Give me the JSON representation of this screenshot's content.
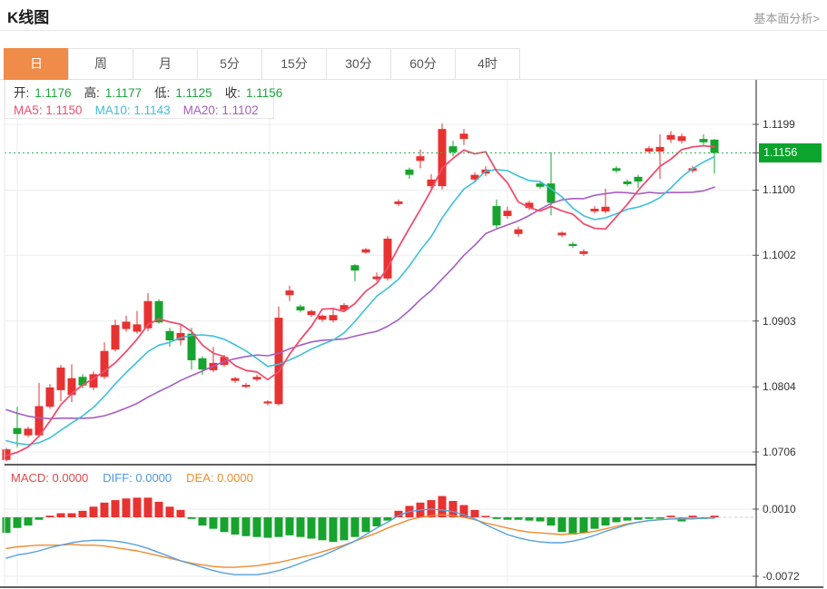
{
  "header": {
    "title": "K线图",
    "link": "基本面分析>"
  },
  "tabs": {
    "selected_key": "day",
    "items": [
      {
        "key": "day",
        "label": "日"
      },
      {
        "key": "week",
        "label": "周"
      },
      {
        "key": "month",
        "label": "月"
      },
      {
        "key": "5min",
        "label": "5分"
      },
      {
        "key": "15min",
        "label": "15分"
      },
      {
        "key": "30min",
        "label": "30分"
      },
      {
        "key": "60min",
        "label": "60分"
      },
      {
        "key": "4hour",
        "label": "4时"
      }
    ]
  },
  "legend": {
    "ohlc": [
      {
        "label": "开:",
        "value": "1.1176"
      },
      {
        "label": "高:",
        "value": "1.1177"
      },
      {
        "label": "低:",
        "value": "1.1125"
      },
      {
        "label": "收:",
        "value": "1.1156"
      }
    ],
    "ma": [
      {
        "label": "MA5:",
        "value": "1.1150",
        "color_key": "ma5"
      },
      {
        "label": "MA10:",
        "value": "1.1143",
        "color_key": "ma10"
      },
      {
        "label": "MA20:",
        "value": "1.1102",
        "color_key": "ma20"
      }
    ]
  },
  "macd_header": [
    {
      "label": "MACD:",
      "value": "0.0000",
      "color": "#e04848"
    },
    {
      "label": "DIFF:",
      "value": "0.0000",
      "color": "#4f97e0"
    },
    {
      "label": "DEA:",
      "value": "0.0000",
      "color": "#ef8e2c"
    }
  ],
  "colors": {
    "up": "#e73232",
    "down": "#17a32e",
    "ma5": "#ef4e6e",
    "ma10": "#3ec0d8",
    "ma20": "#a55ec2",
    "diff": "#57a0e0",
    "dea": "#ef8a2e",
    "ohlc_value": "#1da63d",
    "label_text": "#333333",
    "current_line": "#2db24f",
    "price_tag_bg": "#0ba42c",
    "tab_accent": "#ef8c49",
    "grid": "#ededed",
    "frame_dark": "#2b2b2b",
    "frame_light": "#e8e8e8"
  },
  "chart_data": {
    "type": "candlestick+macd",
    "title": "K线图",
    "legend_position": "top-left",
    "grid": true,
    "price_pane": {
      "y_ticks": [
        "1.1199",
        "1.1100",
        "1.1002",
        "1.0903",
        "1.0804",
        "1.0706"
      ],
      "current_price": "1.1156",
      "ma_periods": [
        5,
        10,
        20
      ],
      "ma_preroll_closes": [
        1.084,
        1.0836,
        1.0832,
        1.0828,
        1.0824,
        1.082,
        1.0815,
        1.081,
        1.0805,
        1.08,
        1.079,
        1.0775,
        1.076,
        1.0745,
        1.073,
        1.0718,
        1.0708,
        1.07,
        1.0694,
        1.069
      ],
      "candles_ohlc": [
        [
          1.0694,
          1.0712,
          1.0692,
          1.071
        ],
        [
          1.0742,
          1.0774,
          1.0713,
          1.0733
        ],
        [
          1.0731,
          1.0744,
          1.0728,
          1.0741
        ],
        [
          1.0731,
          1.081,
          1.0728,
          1.0775
        ],
        [
          1.0774,
          1.0808,
          1.0771,
          1.0803
        ],
        [
          1.0799,
          1.0837,
          1.0782,
          1.0833
        ],
        [
          1.0792,
          1.0838,
          1.0781,
          1.0817
        ],
        [
          1.0819,
          1.0823,
          1.0802,
          1.0806
        ],
        [
          1.0803,
          1.0827,
          1.0799,
          1.0823
        ],
        [
          1.0819,
          1.0871,
          1.0816,
          1.0858
        ],
        [
          1.086,
          1.0905,
          1.0857,
          1.0897
        ],
        [
          1.0891,
          1.0911,
          1.0887,
          1.0902
        ],
        [
          1.0887,
          1.0918,
          1.0884,
          1.0898
        ],
        [
          1.0892,
          1.0945,
          1.0888,
          1.0933
        ],
        [
          1.0933,
          1.0936,
          1.0899,
          1.0901
        ],
        [
          1.0888,
          1.0893,
          1.0864,
          1.0874
        ],
        [
          1.0874,
          1.0899,
          1.0867,
          1.0885
        ],
        [
          1.0884,
          1.0893,
          1.083,
          1.0844
        ],
        [
          1.0847,
          1.085,
          1.0822,
          1.083
        ],
        [
          1.0829,
          1.0864,
          1.0826,
          1.084
        ],
        [
          1.0837,
          1.0852,
          1.0834,
          1.0849
        ],
        [
          1.0813,
          1.0819,
          1.081,
          1.0817
        ],
        [
          1.0804,
          1.081,
          1.0802,
          1.0807
        ],
        [
          1.0815,
          1.0822,
          1.0812,
          1.0819
        ],
        [
          1.0779,
          1.0784,
          1.0776,
          1.0782
        ],
        [
          1.0778,
          1.0925,
          1.0776,
          1.0908
        ],
        [
          1.0942,
          1.0956,
          1.0933,
          1.0949
        ],
        [
          1.0925,
          1.0928,
          1.0916,
          1.0919
        ],
        [
          1.0912,
          1.092,
          1.0909,
          1.0918
        ],
        [
          1.0905,
          1.0913,
          1.0902,
          1.0911
        ],
        [
          1.0904,
          1.0922,
          1.0901,
          1.0912
        ],
        [
          1.092,
          1.093,
          1.0917,
          1.0927
        ],
        [
          1.0987,
          1.0989,
          1.0963,
          1.0979
        ],
        [
          1.1006,
          1.1013,
          1.1004,
          1.1011
        ],
        [
          1.0966,
          1.0976,
          1.0963,
          1.097
        ],
        [
          1.0967,
          1.1031,
          1.0964,
          1.1027
        ],
        [
          1.1079,
          1.1086,
          1.1076,
          1.1083
        ],
        [
          1.1131,
          1.1134,
          1.1117,
          1.1123
        ],
        [
          1.1144,
          1.1161,
          1.1133,
          1.1151
        ],
        [
          1.1106,
          1.1124,
          1.1102,
          1.1116
        ],
        [
          1.1106,
          1.12,
          1.1101,
          1.1192
        ],
        [
          1.1166,
          1.1174,
          1.1151,
          1.1157
        ],
        [
          1.1177,
          1.1192,
          1.1168,
          1.1185
        ],
        [
          1.1116,
          1.1127,
          1.1112,
          1.1123
        ],
        [
          1.1125,
          1.1136,
          1.1121,
          1.1131
        ],
        [
          1.1076,
          1.1086,
          1.1042,
          1.1047
        ],
        [
          1.1061,
          1.1075,
          1.1057,
          1.1069
        ],
        [
          1.1034,
          1.1045,
          1.103,
          1.1041
        ],
        [
          1.1073,
          1.1084,
          1.107,
          1.1081
        ],
        [
          1.111,
          1.1113,
          1.1102,
          1.1105
        ],
        [
          1.111,
          1.1157,
          1.1062,
          1.1081
        ],
        [
          1.1032,
          1.1038,
          1.1029,
          1.1036
        ],
        [
          1.1019,
          1.1022,
          1.1013,
          1.1016
        ],
        [
          1.1004,
          1.1011,
          1.1001,
          1.1008
        ],
        [
          1.1068,
          1.1076,
          1.1065,
          1.1072
        ],
        [
          1.1068,
          1.1102,
          1.1065,
          1.1075
        ],
        [
          1.1133,
          1.1136,
          1.1126,
          1.1129
        ],
        [
          1.1113,
          1.1116,
          1.1106,
          1.1109
        ],
        [
          1.112,
          1.1123,
          1.1103,
          1.1113
        ],
        [
          1.1158,
          1.1166,
          1.1155,
          1.1163
        ],
        [
          1.1158,
          1.1184,
          1.1117,
          1.1165
        ],
        [
          1.1176,
          1.1189,
          1.1171,
          1.1183
        ],
        [
          1.1174,
          1.1185,
          1.117,
          1.1181
        ],
        [
          1.1129,
          1.1136,
          1.1126,
          1.1133
        ],
        [
          1.1177,
          1.1184,
          1.1168,
          1.1172
        ],
        [
          1.1176,
          1.1177,
          1.1125,
          1.1156
        ]
      ]
    },
    "macd_pane": {
      "y_ticks": [
        "0.0010",
        "-0.0072"
      ],
      "bars": [
        -0.0019,
        -0.0013,
        -0.001,
        -0.0003,
        0.0002,
        0.0005,
        0.0005,
        0.0008,
        0.0013,
        0.0018,
        0.0021,
        0.0023,
        0.0024,
        0.0024,
        0.0019,
        0.0013,
        0.0009,
        -0.0002,
        -0.001,
        -0.0014,
        -0.0018,
        -0.0021,
        -0.0023,
        -0.0024,
        -0.0025,
        -0.0024,
        -0.0022,
        -0.0024,
        -0.0026,
        -0.0028,
        -0.003,
        -0.0028,
        -0.0024,
        -0.0018,
        -0.0011,
        -0.0004,
        0.0008,
        0.0014,
        0.0018,
        0.0021,
        0.0026,
        0.002,
        0.0015,
        0.0009,
        0.0001,
        -0.0002,
        -0.0003,
        -0.0003,
        -0.0004,
        -0.0005,
        -0.001,
        -0.0018,
        -0.0021,
        -0.0019,
        -0.0014,
        -0.001,
        -0.0006,
        -0.0004,
        -0.0003,
        -0.0002,
        -0.0001,
        0.0002,
        -0.0005,
        0.0002,
        -0.0002,
        0.0002
      ],
      "diff": [
        -0.005,
        -0.0046,
        -0.0044,
        -0.0041,
        -0.0037,
        -0.0034,
        -0.0031,
        -0.0029,
        -0.0028,
        -0.0028,
        -0.0029,
        -0.0031,
        -0.0034,
        -0.0038,
        -0.0043,
        -0.0048,
        -0.0053,
        -0.0057,
        -0.0061,
        -0.0065,
        -0.0068,
        -0.007,
        -0.007,
        -0.007,
        -0.0068,
        -0.0065,
        -0.0061,
        -0.0056,
        -0.0051,
        -0.0047,
        -0.0041,
        -0.0035,
        -0.0029,
        -0.0021,
        -0.0013,
        -0.0006,
        0.0002,
        0.0007,
        0.0009,
        0.001,
        0.0009,
        0.0007,
        0.0003,
        -0.0002,
        -0.0009,
        -0.0015,
        -0.0021,
        -0.0025,
        -0.0028,
        -0.003,
        -0.0031,
        -0.0031,
        -0.0029,
        -0.0026,
        -0.0022,
        -0.0017,
        -0.0013,
        -0.0009,
        -0.0006,
        -0.0004,
        -0.0003,
        -0.0002,
        -0.0002,
        -0.0002,
        -0.0001,
        -0.0001
      ],
      "dea": [
        -0.0038,
        -0.0036,
        -0.0035,
        -0.0034,
        -0.0034,
        -0.0034,
        -0.0033,
        -0.0034,
        -0.0034,
        -0.0035,
        -0.0037,
        -0.0039,
        -0.0041,
        -0.0044,
        -0.0047,
        -0.005,
        -0.0053,
        -0.0056,
        -0.0058,
        -0.006,
        -0.0061,
        -0.0061,
        -0.006,
        -0.0059,
        -0.0057,
        -0.0055,
        -0.0052,
        -0.0049,
        -0.0046,
        -0.0042,
        -0.0038,
        -0.0034,
        -0.0029,
        -0.0024,
        -0.0019,
        -0.0013,
        -0.0008,
        -0.0003,
        0.0,
        0.0002,
        0.0003,
        0.0002,
        0.0,
        -0.0003,
        -0.0007,
        -0.001,
        -0.0013,
        -0.0016,
        -0.0018,
        -0.0019,
        -0.002,
        -0.0021,
        -0.002,
        -0.0019,
        -0.0017,
        -0.0014,
        -0.0011,
        -0.0008,
        -0.0006,
        -0.0004,
        -0.0003,
        -0.0002,
        -0.0001,
        -0.0001,
        -0.0001,
        -0.0001
      ]
    }
  }
}
